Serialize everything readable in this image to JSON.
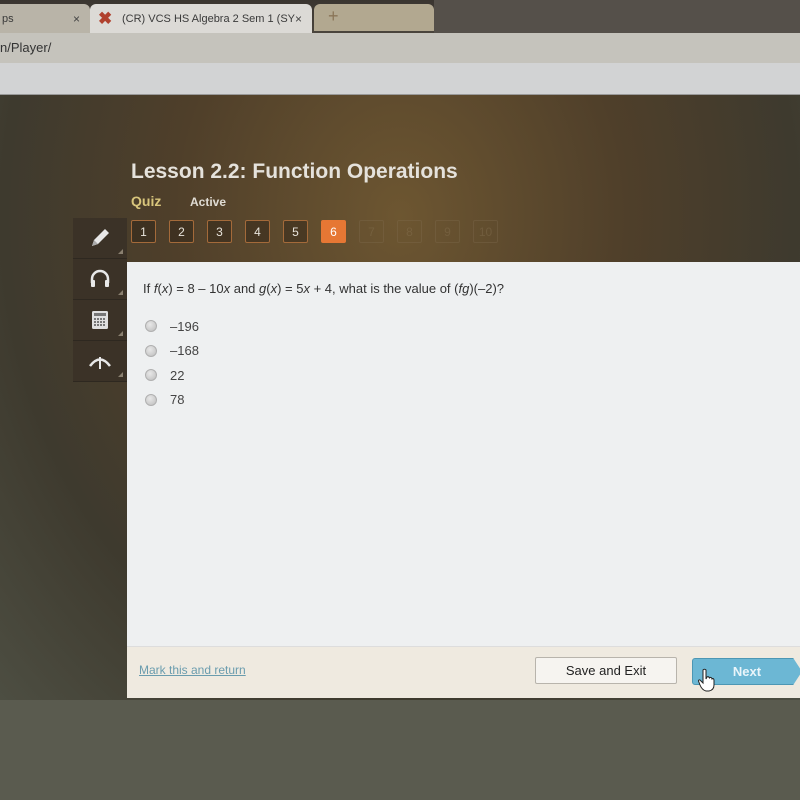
{
  "browser": {
    "tabs": [
      {
        "label": "ps",
        "active": false
      },
      {
        "label": "(CR) VCS HS Algebra 2 Sem 1 (SY",
        "active": true,
        "icon": "x-logo-icon"
      }
    ],
    "close_glyph": "×",
    "new_tab_glyph": "+",
    "url": "n/Player/"
  },
  "header": {
    "title": "Lesson 2.2: Function Operations",
    "type": "Quiz",
    "status": "Active"
  },
  "question_nav": {
    "items": [
      {
        "label": "1",
        "state": "answered"
      },
      {
        "label": "2",
        "state": "answered"
      },
      {
        "label": "3",
        "state": "answered"
      },
      {
        "label": "4",
        "state": "answered"
      },
      {
        "label": "5",
        "state": "answered"
      },
      {
        "label": "6",
        "state": "current"
      },
      {
        "label": "7",
        "state": "disabled"
      },
      {
        "label": "8",
        "state": "disabled"
      },
      {
        "label": "9",
        "state": "disabled"
      },
      {
        "label": "10",
        "state": "disabled"
      }
    ]
  },
  "tools": [
    {
      "name": "pencil-icon"
    },
    {
      "name": "headphones-icon"
    },
    {
      "name": "calculator-icon"
    },
    {
      "name": "reference-icon"
    }
  ],
  "question": {
    "parts": [
      "If ",
      "f",
      "(",
      "x",
      ") = 8 – 10",
      "x",
      " and ",
      "g",
      "(",
      "x",
      ") = 5",
      "x",
      " + 4, what is the value of (",
      "fg",
      ")(–2)?"
    ],
    "choices": [
      "–196",
      "–168",
      "22",
      "78"
    ],
    "selected": null
  },
  "footer": {
    "mark_link": "Mark this and return",
    "save_button": "Save and Exit",
    "next_button": "Next"
  },
  "colors": {
    "current_question": "#e67734",
    "next_button": "#6cb7d4",
    "quiz_label": "#d8c57c"
  }
}
